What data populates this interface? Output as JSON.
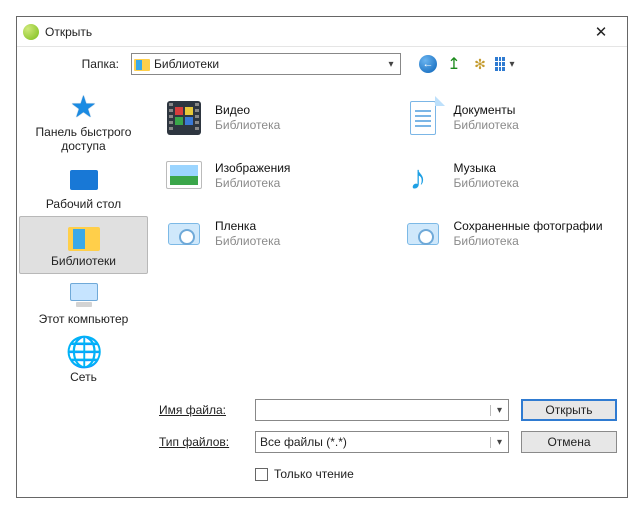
{
  "window": {
    "title": "Открыть"
  },
  "toolbar": {
    "folder_label": "Папка:",
    "current_folder": "Библиотеки"
  },
  "places": {
    "quick_access": "Панель быстрого доступа",
    "desktop": "Рабочий стол",
    "libraries": "Библиотеки",
    "this_pc": "Этот компьютер",
    "network": "Сеть"
  },
  "libraries": [
    {
      "name": "Видео",
      "sub": "Библиотека"
    },
    {
      "name": "Документы",
      "sub": "Библиотека"
    },
    {
      "name": "Изображения",
      "sub": "Библиотека"
    },
    {
      "name": "Музыка",
      "sub": "Библиотека"
    },
    {
      "name": "Пленка",
      "sub": "Библиотека"
    },
    {
      "name": "Сохраненные фотографии",
      "sub": "Библиотека"
    }
  ],
  "footer": {
    "filename_label": "Имя файла:",
    "filename_value": "",
    "filetype_label": "Тип файлов:",
    "filetype_value": "Все файлы (*.*)",
    "readonly_label": "Только чтение",
    "open_btn": "Открыть",
    "cancel_btn": "Отмена"
  }
}
